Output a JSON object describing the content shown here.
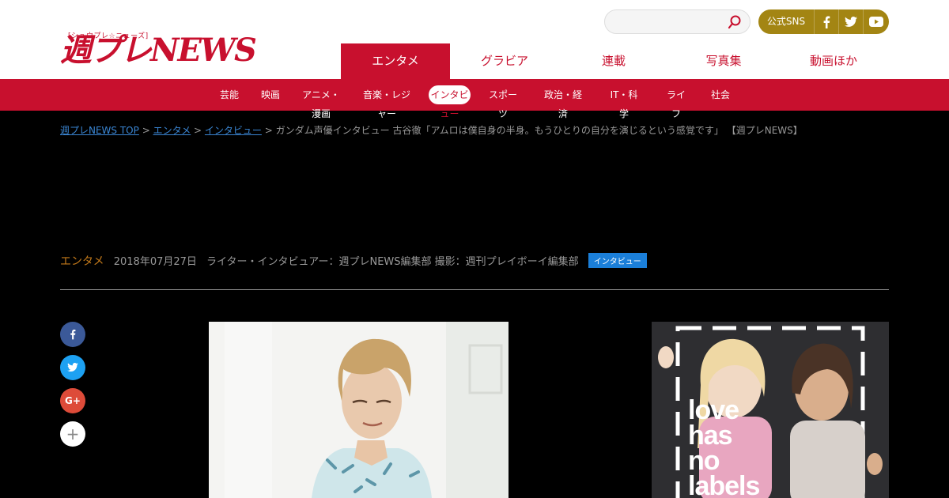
{
  "logo": {
    "sub": "[シュウプレ☆ニューズ]",
    "main": "週プレNEWS"
  },
  "search": {
    "placeholder": ""
  },
  "sns": {
    "label": "公式SNS",
    "items": [
      "facebook",
      "twitter",
      "youtube"
    ]
  },
  "main_nav": [
    {
      "label": "エンタメ",
      "active": true
    },
    {
      "label": "グラビア",
      "active": false
    },
    {
      "label": "連載",
      "active": false
    },
    {
      "label": "写真集",
      "active": false
    },
    {
      "label": "動画ほか",
      "active": false
    }
  ],
  "sub_nav": [
    {
      "label": "芸能",
      "active": false
    },
    {
      "label": "映画",
      "active": false
    },
    {
      "label": "アニメ・漫画",
      "active": false
    },
    {
      "label": "音楽・レジャー",
      "active": false
    },
    {
      "label": "インタビュー",
      "active": true
    },
    {
      "label": "スポーツ",
      "active": false
    },
    {
      "label": "政治・経済",
      "active": false
    },
    {
      "label": "IT・科学",
      "active": false
    },
    {
      "label": "ライフ",
      "active": false
    },
    {
      "label": "社会",
      "active": false
    }
  ],
  "breadcrumb": {
    "home": "週プレNEWS TOP",
    "level1": "エンタメ",
    "level2": "インタビュー",
    "current": "ガンダム声優インタビュー 古谷徹「アムロは僕自身の半身。もうひとりの自分を演じるという感覚です」 【週プレNEWS】"
  },
  "article_meta": {
    "category": "エンタメ",
    "date": "2018年07月27日",
    "author": "ライター・インタビュアー：週プレNEWS編集部 撮影：週刊プレイボーイ編集部",
    "badge": "インタビュー"
  },
  "share": [
    "facebook",
    "twitter",
    "google-plus",
    "more"
  ],
  "ad": {
    "text": [
      "love",
      "has",
      "no",
      "labels"
    ]
  },
  "colors": {
    "brand": "#c8102e",
    "sns_gold": "#a38513",
    "badge_blue": "#1b7fd9",
    "category": "#c47a1a",
    "link": "#3a86d4"
  }
}
